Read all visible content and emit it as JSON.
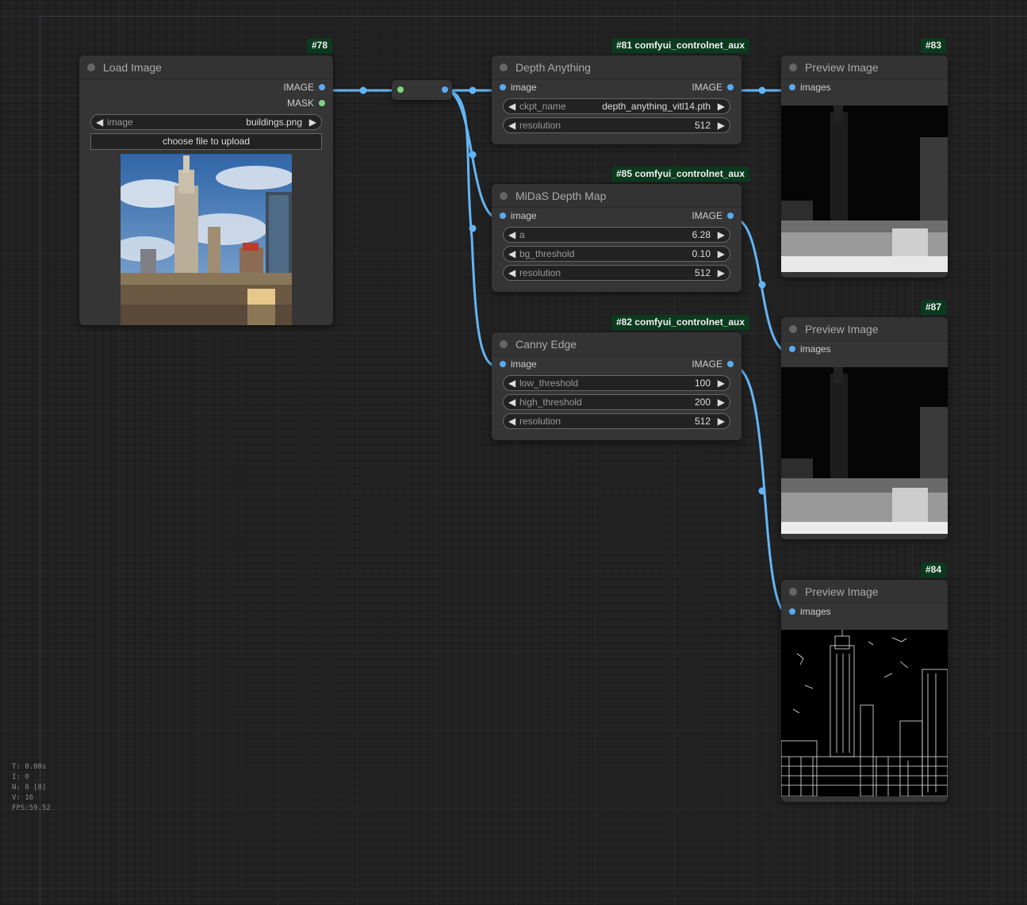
{
  "stats": {
    "time": "T: 0.00s",
    "iterations": "I: 0",
    "nodes": "N: 8 [8]",
    "visible": "V: 16",
    "fps": "FPS:59.52"
  },
  "colors": {
    "wire": "#64b5f6",
    "badge_bg": "#0b3a1e",
    "node_bg": "#353535",
    "canvas_bg": "#222222"
  },
  "nodes": {
    "load_image": {
      "badge": "#78",
      "title": "Load Image",
      "outputs": [
        "IMAGE",
        "MASK"
      ],
      "image_widget": {
        "label": "image",
        "value": "buildings.png"
      },
      "upload_button": "choose file to upload"
    },
    "depth_anything": {
      "badge": "#81 comfyui_controlnet_aux",
      "title": "Depth Anything",
      "input": "image",
      "output": "IMAGE",
      "widgets": [
        {
          "label": "ckpt_name",
          "value": "depth_anything_vitl14.pth"
        },
        {
          "label": "resolution",
          "value": "512"
        }
      ]
    },
    "midas": {
      "badge": "#85 comfyui_controlnet_aux",
      "title": "MiDaS Depth Map",
      "input": "image",
      "output": "IMAGE",
      "widgets": [
        {
          "label": "a",
          "value": "6.28"
        },
        {
          "label": "bg_threshold",
          "value": "0.10"
        },
        {
          "label": "resolution",
          "value": "512"
        }
      ]
    },
    "canny": {
      "badge": "#82 comfyui_controlnet_aux",
      "title": "Canny Edge",
      "input": "image",
      "output": "IMAGE",
      "widgets": [
        {
          "label": "low_threshold",
          "value": "100"
        },
        {
          "label": "high_threshold",
          "value": "200"
        },
        {
          "label": "resolution",
          "value": "512"
        }
      ]
    },
    "preview_83": {
      "badge": "#83",
      "title": "Preview Image",
      "input": "images"
    },
    "preview_87": {
      "badge": "#87",
      "title": "Preview Image",
      "input": "images"
    },
    "preview_84": {
      "badge": "#84",
      "title": "Preview Image",
      "input": "images"
    }
  }
}
